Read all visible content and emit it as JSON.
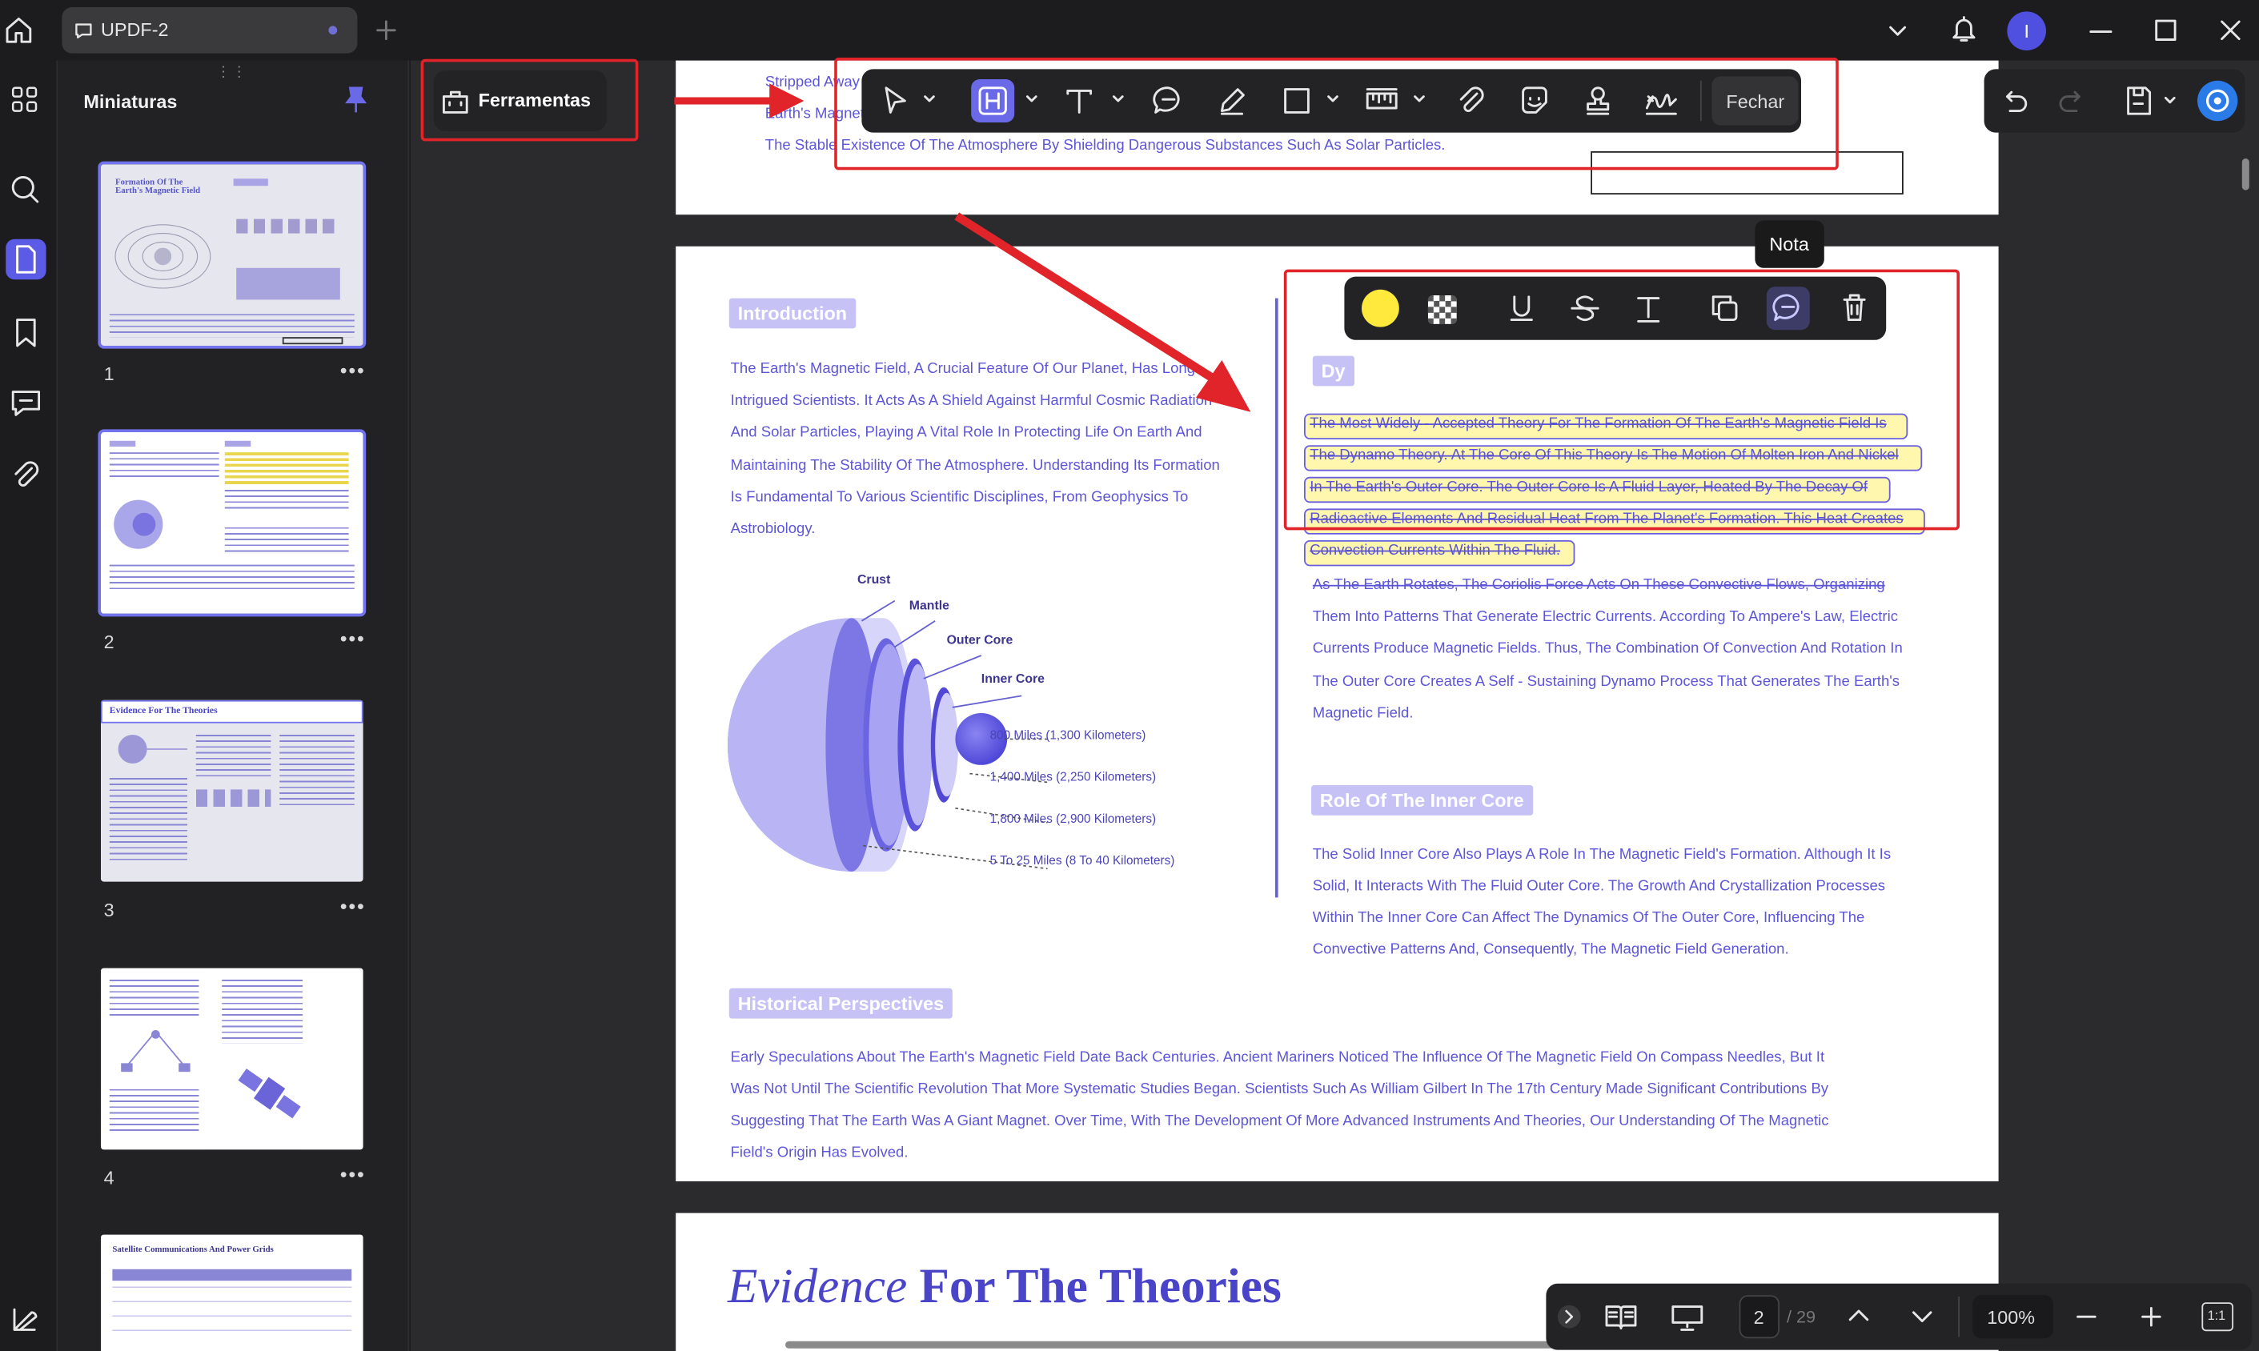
{
  "titlebar": {
    "tab_title": "UPDF-2",
    "avatar_initial": "I"
  },
  "sidebar": {
    "title": "Miniaturas",
    "pages": [
      "1",
      "2",
      "3",
      "4"
    ],
    "more": "•••",
    "thumb_titles": {
      "p1": "Formation Of The Earth's Magnetic Field",
      "p3": "Evidence For The Theories",
      "p5": "Satellite Communications And Power Grids"
    }
  },
  "tools": {
    "label": "Ferramentas",
    "close_label": "Fechar"
  },
  "tooltip": {
    "note": "Nota"
  },
  "page1": {
    "line1": "Stripped Away",
    "line2": "Earth's Magnet",
    "line3": "The Stable Existence Of The Atmosphere By Shielding Dangerous Substances Such As Solar Particles."
  },
  "page2": {
    "intro_head": "Introduction",
    "intro_lines": [
      "The Earth's Magnetic Field, A Crucial Feature Of Our Planet, Has Long",
      "Intrigued Scientists. It Acts As A Shield Against Harmful Cosmic Radiation",
      "And Solar Particles, Playing A Vital Role In Protecting Life On Earth And",
      "Maintaining The Stability Of The Atmosphere. Understanding Its Formation",
      "Is Fundamental To Various Scientific Disciplines, From Geophysics To",
      "Astrobiology."
    ],
    "diagram": {
      "crust": "Crust",
      "mantle": "Mantle",
      "outer_core": "Outer Core",
      "inner_core": "Inner Core",
      "d1": "800 Miles (1,300 Kilometers)",
      "d2": "1,400 Miles (2,250 Kilometers)",
      "d3": "1,800 Miles (2,900 Kilometers)",
      "d4": "5 To 25 Miles (8 To 40 Kilometers)"
    },
    "dyn_head": "Dy",
    "highlighted_lines": [
      "The Most Widely - Accepted Theory For The Formation Of The Earth's Magnetic Field Is",
      "The Dynamo Theory. At The Core Of This Theory Is The Motion Of Molten Iron And Nickel",
      "In The Earth's Outer Core. The Outer Core Is A Fluid Layer, Heated By The Decay Of",
      "Radioactive Elements And Residual Heat From The Planet's Formation. This Heat Creates",
      "Convection Currents Within The Fluid."
    ],
    "dyn_lines": [
      "As The Earth Rotates, The Coriolis Force Acts On These Convective Flows, Organizing",
      "Them Into Patterns That Generate Electric Currents. According To Ampere's Law, Electric",
      "Currents Produce Magnetic Fields. Thus, The Combination Of Convection And Rotation In",
      "The Outer Core Creates A Self - Sustaining Dynamo Process That Generates The Earth's",
      "Magnetic Field."
    ],
    "inner_head": "Role Of The Inner Core",
    "inner_lines": [
      "The Solid Inner Core Also Plays A Role In The Magnetic Field's Formation. Although It Is",
      "Solid, It Interacts With The Fluid Outer Core. The Growth And Crystallization Processes",
      "Within The Inner Core Can Affect The Dynamics Of The Outer Core, Influencing The",
      "Convective Patterns And, Consequently, The Magnetic Field Generation."
    ],
    "hist_head": "Historical Perspectives",
    "hist_lines": [
      "Early Speculations About The Earth's Magnetic Field Date Back Centuries. Ancient Mariners Noticed The Influence Of The Magnetic Field On Compass Needles, But It",
      "Was Not Until The Scientific Revolution That More Systematic Studies Began. Scientists Such As William Gilbert In The 17th Century Made Significant Contributions By",
      "Suggesting That The Earth Was A Giant Magnet. Over Time, With The Development Of More Advanced Instruments And Theories, Our Understanding Of The Magnetic",
      "Field's Origin Has Evolved."
    ]
  },
  "page3": {
    "title_italic": "Evidence",
    "title_bold": "For The Theories"
  },
  "bottom": {
    "page_current": "2",
    "page_total": "/ 29",
    "zoom": "100%",
    "fit": "1:1"
  },
  "colors": {
    "accent": "#6a6ae8",
    "highlight": "#ffe93c",
    "red_box": "#e0242a",
    "doc_text": "#5d56d8"
  }
}
